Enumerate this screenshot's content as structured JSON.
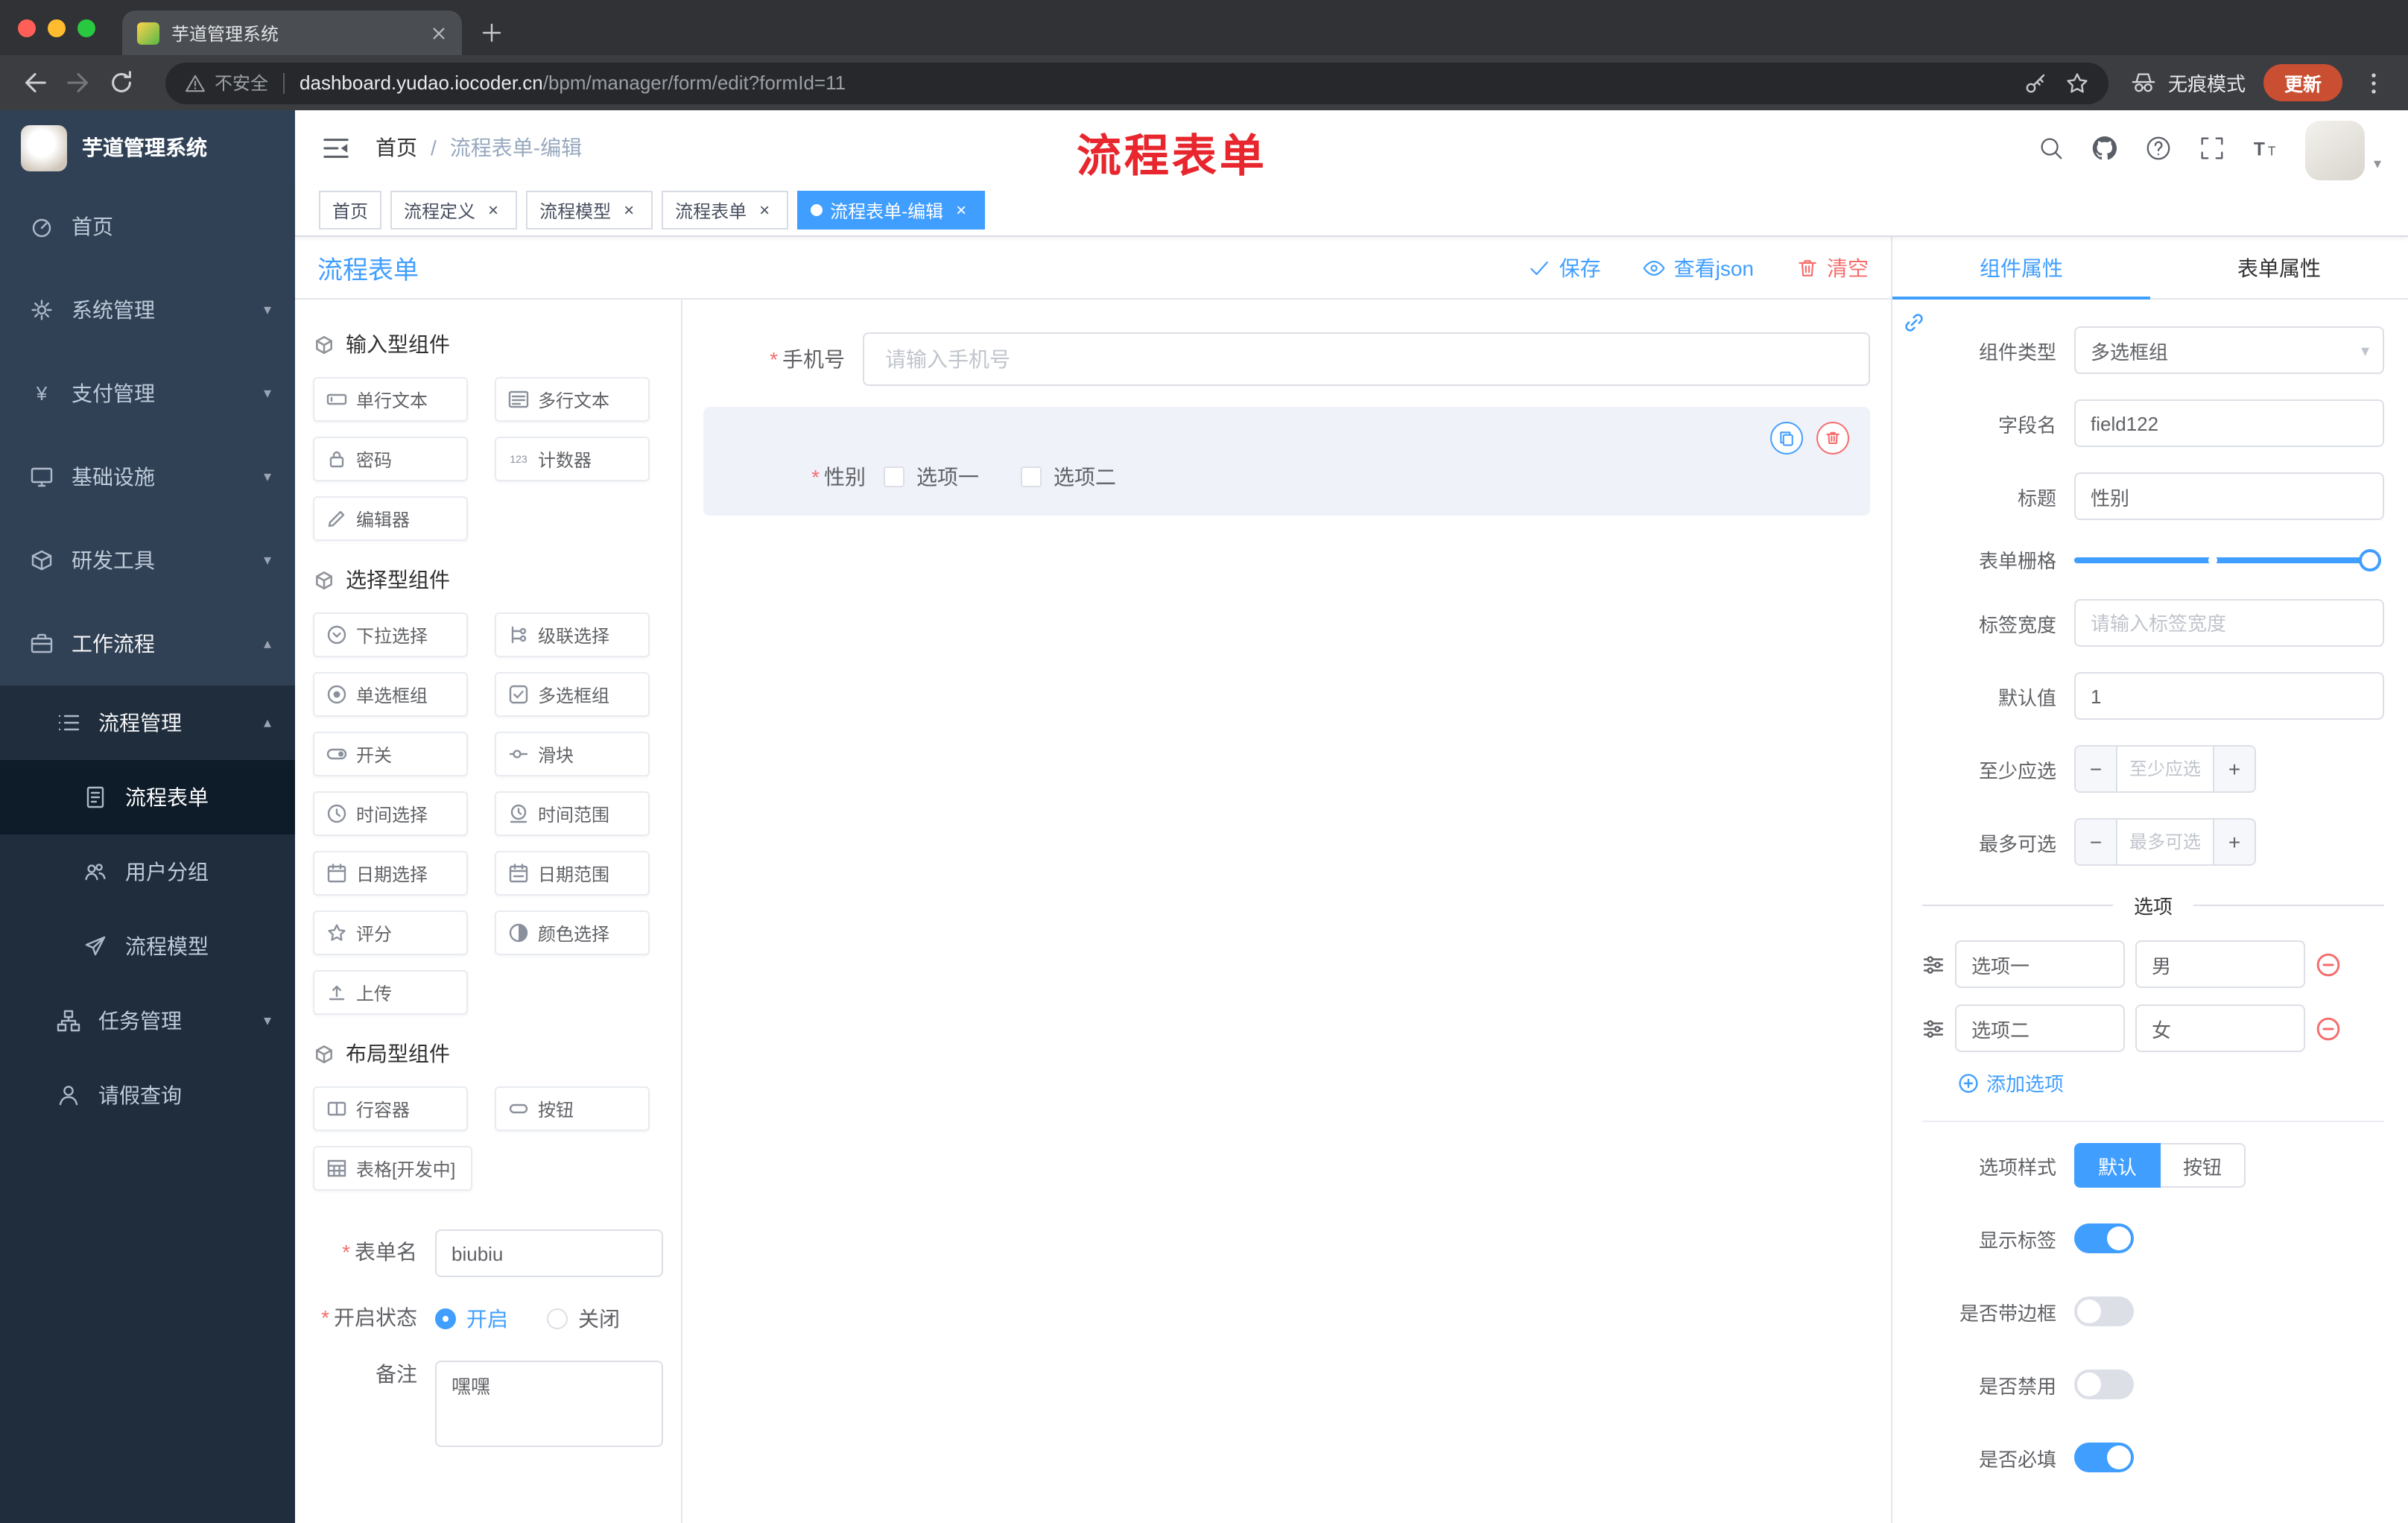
{
  "browser": {
    "tab_title": "芋道管理系统",
    "security_label": "不安全",
    "url_domain": "dashboard.yudao.iocoder.cn",
    "url_path": "/bpm/manager/form/edit?formId=11",
    "incognito_label": "无痕模式",
    "update_label": "更新"
  },
  "sidebar": {
    "brand": "芋道管理系统",
    "items": [
      {
        "key": "home",
        "label": "首页",
        "icon": "home",
        "level": 1
      },
      {
        "key": "system",
        "label": "系统管理",
        "icon": "gear",
        "level": 1,
        "chevron": "down"
      },
      {
        "key": "payment",
        "label": "支付管理",
        "icon": "yen",
        "level": 1,
        "chevron": "down"
      },
      {
        "key": "infra",
        "label": "基础设施",
        "icon": "monitor",
        "level": 1,
        "chevron": "down"
      },
      {
        "key": "devtools",
        "label": "研发工具",
        "icon": "tool",
        "level": 1,
        "chevron": "down"
      },
      {
        "key": "workflow",
        "label": "工作流程",
        "icon": "briefcase",
        "level": 1,
        "chevron": "up",
        "open": true
      },
      {
        "key": "process-manage",
        "label": "流程管理",
        "icon": "list",
        "level": 2,
        "chevron": "up",
        "open": true
      },
      {
        "key": "process-form",
        "label": "流程表单",
        "icon": "form",
        "level": 3,
        "active": true
      },
      {
        "key": "user-group",
        "label": "用户分组",
        "icon": "users",
        "level": 3
      },
      {
        "key": "process-model",
        "label": "流程模型",
        "icon": "send",
        "level": 3
      },
      {
        "key": "task-manage",
        "label": "任务管理",
        "icon": "tree",
        "level": 2,
        "chevron": "down"
      },
      {
        "key": "leave-query",
        "label": "请假查询",
        "icon": "user",
        "level": 2
      }
    ]
  },
  "header": {
    "breadcrumb_home": "首页",
    "breadcrumb_separator": "/",
    "breadcrumb_current": "流程表单-编辑",
    "annotation": "流程表单"
  },
  "tags": [
    {
      "key": "home",
      "label": "首页",
      "closable": false,
      "active": false
    },
    {
      "key": "process-definition",
      "label": "流程定义",
      "closable": true,
      "active": false
    },
    {
      "key": "process-model",
      "label": "流程模型",
      "closable": true,
      "active": false
    },
    {
      "key": "process-form",
      "label": "流程表单",
      "closable": true,
      "active": false
    },
    {
      "key": "process-form-edit",
      "label": "流程表单-编辑",
      "closable": true,
      "active": true
    }
  ],
  "toolbar": {
    "title": "流程表单",
    "save": "保存",
    "view_json": "查看json",
    "clear": "清空"
  },
  "palette": {
    "groups": [
      {
        "title": "输入型组件",
        "items": [
          {
            "key": "single-text",
            "label": "单行文本",
            "icon": "input"
          },
          {
            "key": "multi-text",
            "label": "多行文本",
            "icon": "textarea"
          },
          {
            "key": "password",
            "label": "密码",
            "icon": "password"
          },
          {
            "key": "counter",
            "label": "计数器",
            "icon": "counter"
          },
          {
            "key": "editor",
            "label": "编辑器",
            "icon": "editor"
          }
        ]
      },
      {
        "title": "选择型组件",
        "items": [
          {
            "key": "select",
            "label": "下拉选择",
            "icon": "select"
          },
          {
            "key": "cascader",
            "label": "级联选择",
            "icon": "cascader"
          },
          {
            "key": "radio-group",
            "label": "单选框组",
            "icon": "radio"
          },
          {
            "key": "checkbox-group",
            "label": "多选框组",
            "icon": "checkbox"
          },
          {
            "key": "switch",
            "label": "开关",
            "icon": "switch"
          },
          {
            "key": "slider",
            "label": "滑块",
            "icon": "slider"
          },
          {
            "key": "time",
            "label": "时间选择",
            "icon": "time"
          },
          {
            "key": "time-range",
            "label": "时间范围",
            "icon": "time-range"
          },
          {
            "key": "date",
            "label": "日期选择",
            "icon": "date"
          },
          {
            "key": "date-range",
            "label": "日期范围",
            "icon": "date-range"
          },
          {
            "key": "rate",
            "label": "评分",
            "icon": "rate"
          },
          {
            "key": "color",
            "label": "颜色选择",
            "icon": "color"
          },
          {
            "key": "upload",
            "label": "上传",
            "icon": "upload"
          }
        ]
      },
      {
        "title": "布局型组件",
        "items": [
          {
            "key": "row",
            "label": "行容器",
            "icon": "row"
          },
          {
            "key": "button",
            "label": "按钮",
            "icon": "button"
          },
          {
            "key": "table",
            "label": "表格[开发中]",
            "icon": "table"
          }
        ]
      }
    ]
  },
  "form_meta": {
    "name_label": "表单名",
    "name_value": "biubiu",
    "status_label": "开启状态",
    "status_on": "开启",
    "status_off": "关闭",
    "remark_label": "备注",
    "remark_value": "嘿嘿"
  },
  "canvas": {
    "phone": {
      "label": "手机号",
      "placeholder": "请输入手机号"
    },
    "gender": {
      "label": "性别",
      "options": [
        "选项一",
        "选项二"
      ]
    }
  },
  "props": {
    "tab_component": "组件属性",
    "tab_form": "表单属性",
    "component_type_label": "组件类型",
    "component_type_value": "多选框组",
    "field_name_label": "字段名",
    "field_name_value": "field122",
    "title_label": "标题",
    "title_value": "性别",
    "grid_label": "表单栅格",
    "label_width_label": "标签宽度",
    "label_width_placeholder": "请输入标签宽度",
    "default_label": "默认值",
    "default_value": "1",
    "min_label": "至少应选",
    "min_placeholder": "至少应选",
    "max_label": "最多可选",
    "max_placeholder": "最多可选",
    "options_title": "选项",
    "options": [
      {
        "label": "选项一",
        "value": "男"
      },
      {
        "label": "选项二",
        "value": "女"
      }
    ],
    "add_option": "添加选项",
    "option_style_label": "选项样式",
    "option_style_default": "默认",
    "option_style_button": "按钮",
    "switches": [
      {
        "key": "show-label",
        "label": "显示标签",
        "on": true
      },
      {
        "key": "bordered",
        "label": "是否带边框",
        "on": false
      },
      {
        "key": "disabled",
        "label": "是否禁用",
        "on": false
      },
      {
        "key": "required",
        "label": "是否必填",
        "on": true
      }
    ]
  },
  "icons": {
    "chevron_down": "▾",
    "chevron_up": "▴",
    "caret_down": "▾",
    "close": "×",
    "minus": "−",
    "plus": "+",
    "required_mark": "*"
  },
  "colors": {
    "primary": "#409eff",
    "danger": "#f56c6c",
    "annotation_red": "#e8262d",
    "sidebar_bg": "#304156",
    "sidebar_sub_bg": "#1f2d3d",
    "update_button": "#ca4e32"
  }
}
